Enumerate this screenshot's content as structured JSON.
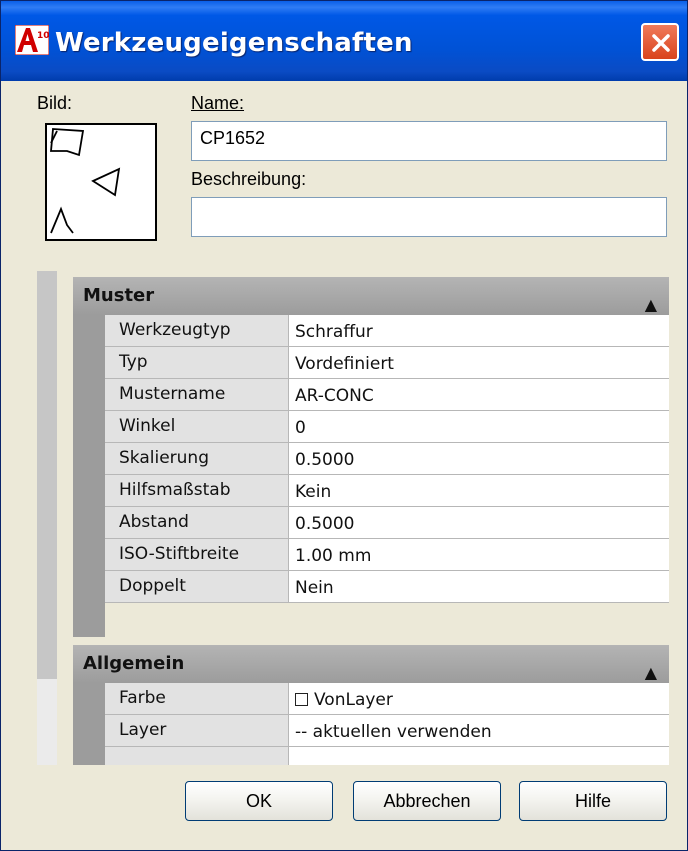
{
  "window": {
    "title": "Werkzeugeigenschaften",
    "icon_text": "A10",
    "icon": "autocad-icon",
    "close_icon": "close-icon",
    "colors": {
      "titlebar": "#0052d6",
      "close": "#d9431d",
      "body": "#ece9d8"
    }
  },
  "form": {
    "bild_label": "Bild:",
    "name_label": "Name:",
    "name_value": "CP1652",
    "beschreibung_label": "Beschreibung:",
    "beschreibung_value": ""
  },
  "properties": {
    "categories": [
      {
        "label": "Muster",
        "collapse_glyph": "▲",
        "rows": [
          {
            "name": "Werkzeugtyp",
            "value": "Schraffur"
          },
          {
            "name": "Typ",
            "value": "Vordefiniert"
          },
          {
            "name": "Mustername",
            "value": "AR-CONC"
          },
          {
            "name": "Winkel",
            "value": "0"
          },
          {
            "name": "Skalierung",
            "value": "0.5000"
          },
          {
            "name": "Hilfsmaßstab",
            "value": "Kein"
          },
          {
            "name": "Abstand",
            "value": "0.5000"
          },
          {
            "name": "ISO-Stiftbreite",
            "value": "1.00 mm"
          },
          {
            "name": "Doppelt",
            "value": "Nein"
          }
        ]
      },
      {
        "label": "Allgemein",
        "collapse_glyph": "▲",
        "rows": [
          {
            "name": "Farbe",
            "value": "VonLayer",
            "has_color_swatch": true
          },
          {
            "name": "Layer",
            "value": "-- aktuellen verwenden"
          }
        ]
      }
    ]
  },
  "buttons": {
    "ok": "OK",
    "cancel": "Abbrechen",
    "help": "Hilfe"
  }
}
